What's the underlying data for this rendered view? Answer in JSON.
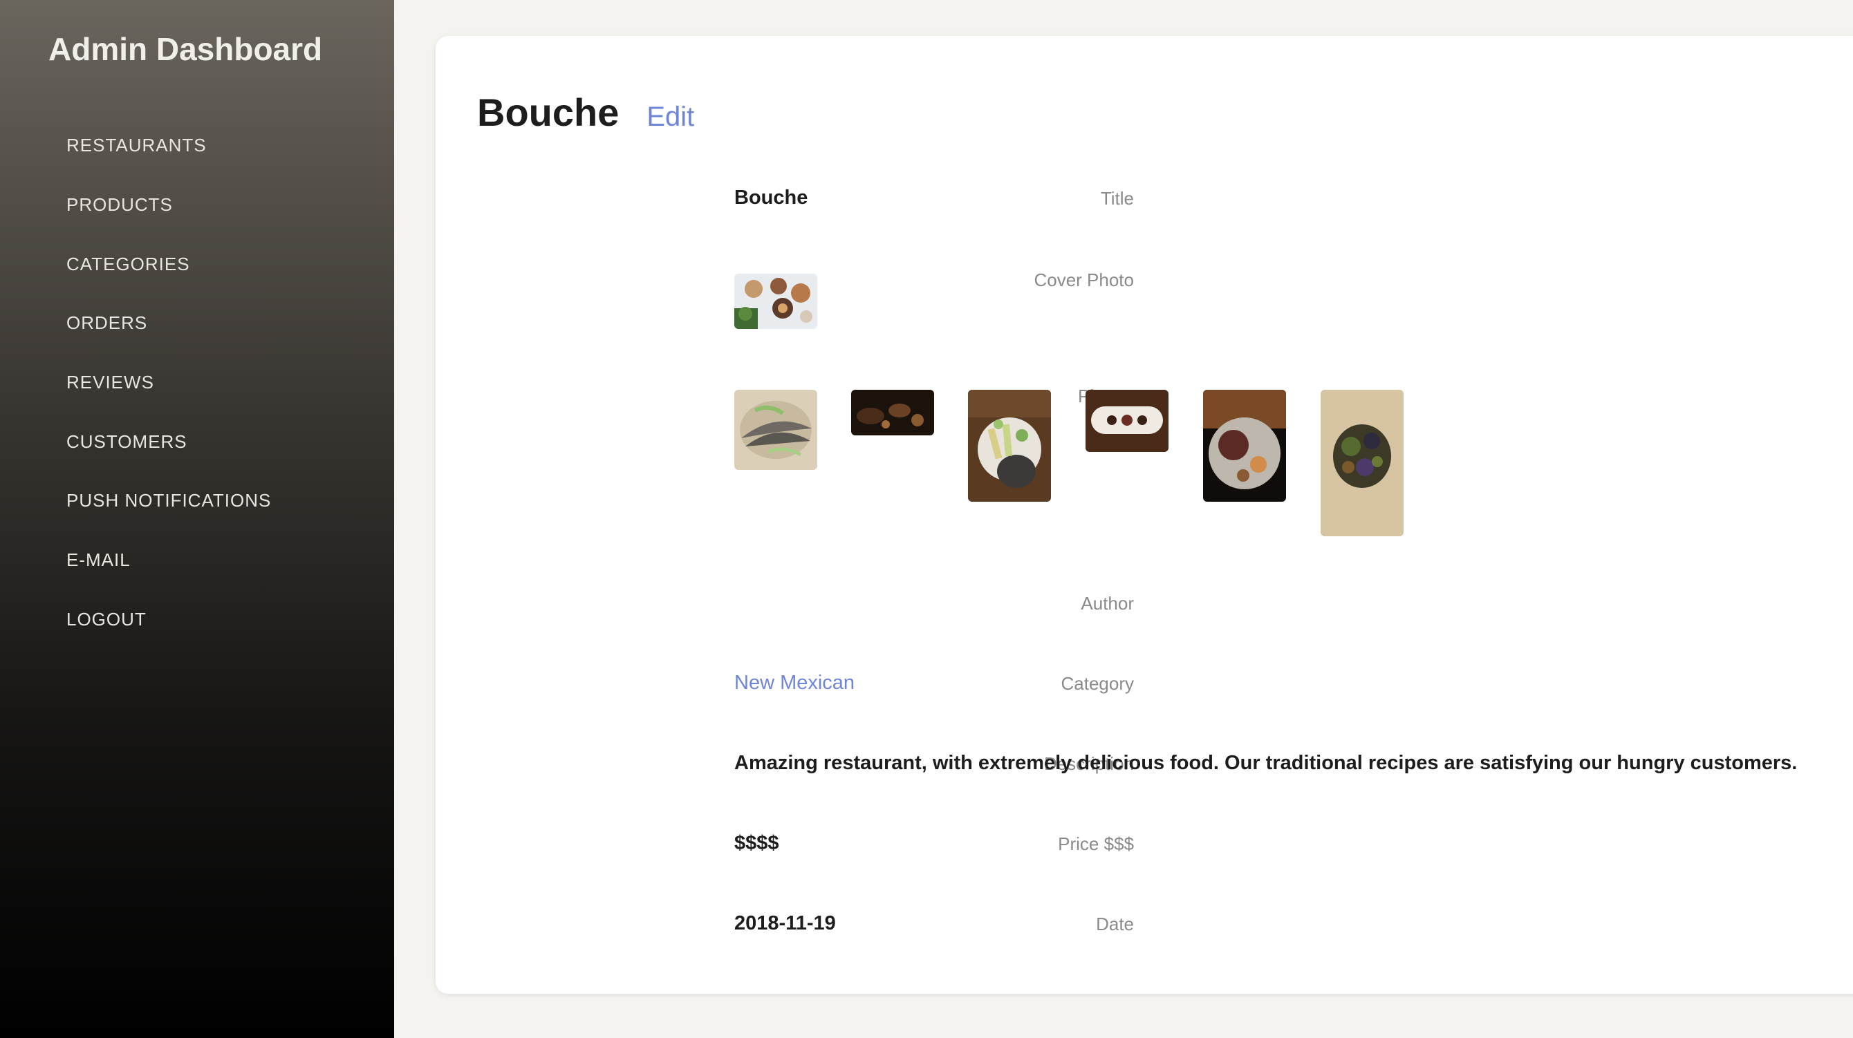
{
  "sidebar": {
    "title": "Admin Dashboard",
    "items": [
      {
        "label": "RESTAURANTS"
      },
      {
        "label": "PRODUCTS"
      },
      {
        "label": "CATEGORIES"
      },
      {
        "label": "ORDERS"
      },
      {
        "label": "REVIEWS"
      },
      {
        "label": "CUSTOMERS"
      },
      {
        "label": "PUSH NOTIFICATIONS"
      },
      {
        "label": "E-MAIL"
      },
      {
        "label": "LOGOUT"
      }
    ]
  },
  "detail": {
    "heading": "Bouche",
    "edit_label": "Edit",
    "fields": {
      "title": {
        "label": "Title",
        "value": "Bouche"
      },
      "cover_photo": {
        "label": "Cover Photo"
      },
      "photos": {
        "label": "Photos"
      },
      "author": {
        "label": "Author",
        "value": ""
      },
      "category": {
        "label": "Category",
        "value": "New Mexican"
      },
      "description": {
        "label": "Description",
        "value": "Amazing restaurant, with extremely delicious food. Our traditional recipes are satisfying our hungry customers."
      },
      "price": {
        "label": "Price $$$",
        "value": "$$$$"
      },
      "date": {
        "label": "Date",
        "value": "2018-11-19"
      }
    }
  },
  "colors": {
    "accent_link": "#6f86d6",
    "page_background": "#f4f3f0",
    "card_background": "#ffffff"
  }
}
